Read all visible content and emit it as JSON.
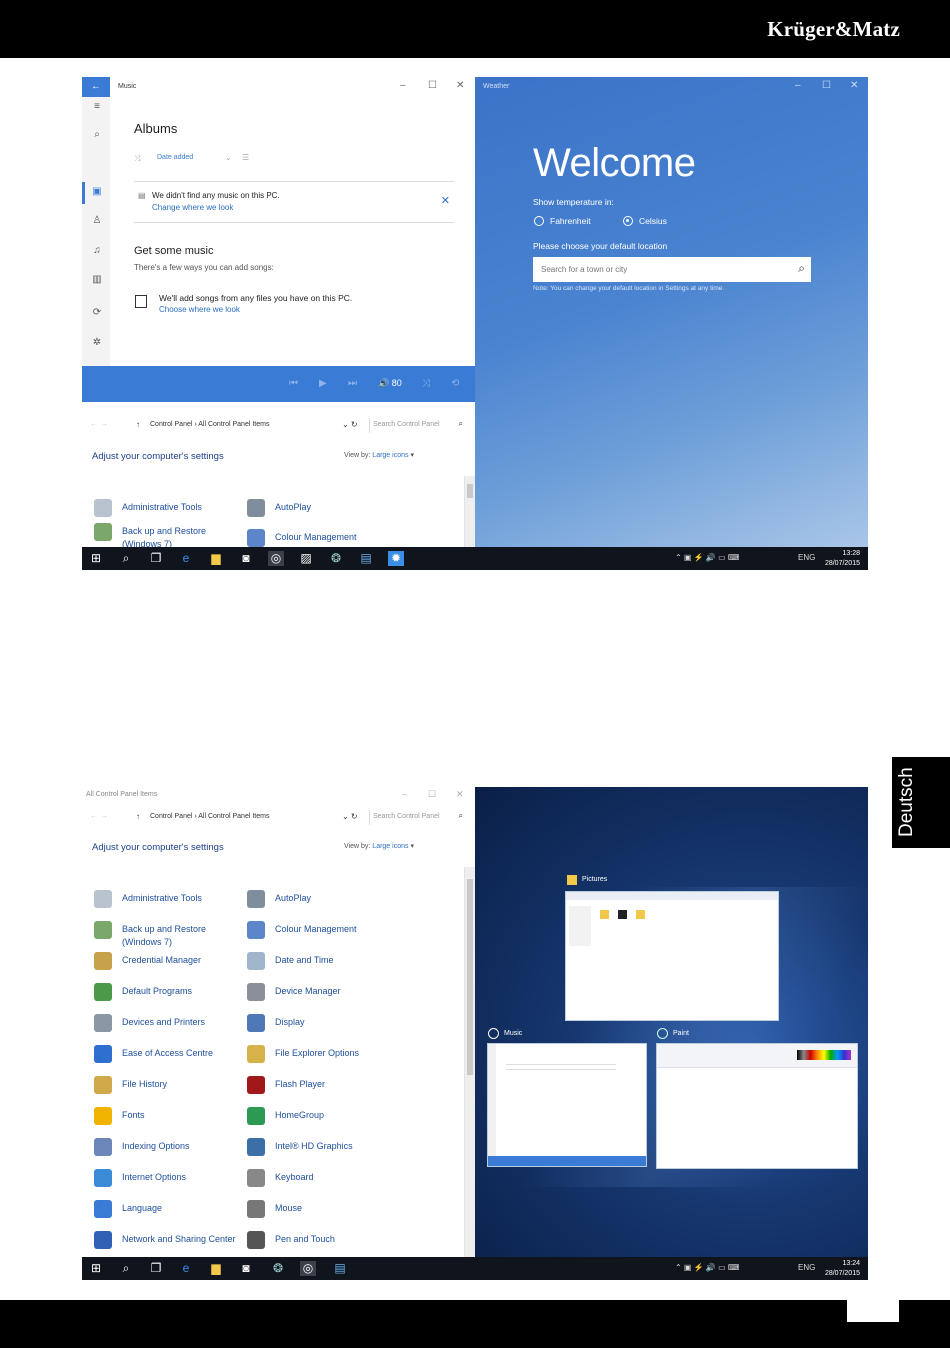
{
  "header": {
    "brand": "Krüger&Matz"
  },
  "language_tab": "Deutsch",
  "shot1": {
    "music": {
      "title": "Music",
      "albums": "Albums",
      "filter": "Date added",
      "no_music": "We didn't find any music on this PC.",
      "change_link": "Change where we look",
      "get_music": "Get some music",
      "ways": "There's a few ways you can add songs:",
      "add_songs": "We'll add songs from any files you have on this PC.",
      "choose_link": "Choose where we look",
      "volume": "80"
    },
    "weather": {
      "title": "Weather",
      "welcome": "Welcome",
      "show_temp": "Show temperature in:",
      "fahrenheit": "Fahrenheit",
      "celsius": "Celsius",
      "choose_location": "Please choose your default location",
      "search_placeholder": "Search for a town or city",
      "note": "Note: You can change your default location in Settings at any time."
    },
    "control_panel": {
      "title": "All Control Panel Items",
      "crumb": "Control Panel  ›  All Control Panel Items",
      "search_placeholder": "Search Control Panel",
      "adjust": "Adjust your computer's settings",
      "view_by_label": "View by:",
      "view_by_value": "Large icons",
      "items": [
        "Administrative Tools",
        "AutoPlay",
        "Back up and Restore (Windows 7)",
        "Colour Management"
      ]
    },
    "taskbar": {
      "lang": "ENG",
      "time": "13:28",
      "date": "28/07/2015"
    }
  },
  "shot2": {
    "control_panel": {
      "title": "All Control Panel Items",
      "crumb": "Control Panel  ›  All Control Panel Items",
      "search_placeholder": "Search Control Panel",
      "adjust": "Adjust your computer's settings",
      "view_by_label": "View by:",
      "view_by_value": "Large icons",
      "items_left": [
        "Administrative Tools",
        "Back up and Restore (Windows 7)",
        "Credential Manager",
        "Default Programs",
        "Devices and Printers",
        "Ease of Access Centre",
        "File History",
        "Fonts",
        "Indexing Options",
        "Internet Options",
        "Language",
        "Network and Sharing Center"
      ],
      "items_right": [
        "AutoPlay",
        "Colour Management",
        "Date and Time",
        "Device Manager",
        "Display",
        "File Explorer Options",
        "Flash Player",
        "HomeGroup",
        "Intel® HD Graphics",
        "Keyboard",
        "Mouse",
        "Pen and Touch"
      ]
    },
    "task_view": {
      "pictures": "Pictures",
      "music": "Music",
      "paint": "Paint"
    },
    "taskbar": {
      "lang": "ENG",
      "time": "13:24",
      "date": "28/07/2015"
    }
  },
  "colors": {
    "accent": "#3a7bd5",
    "link": "#1e4f9c",
    "taskbar": "#10141c"
  }
}
